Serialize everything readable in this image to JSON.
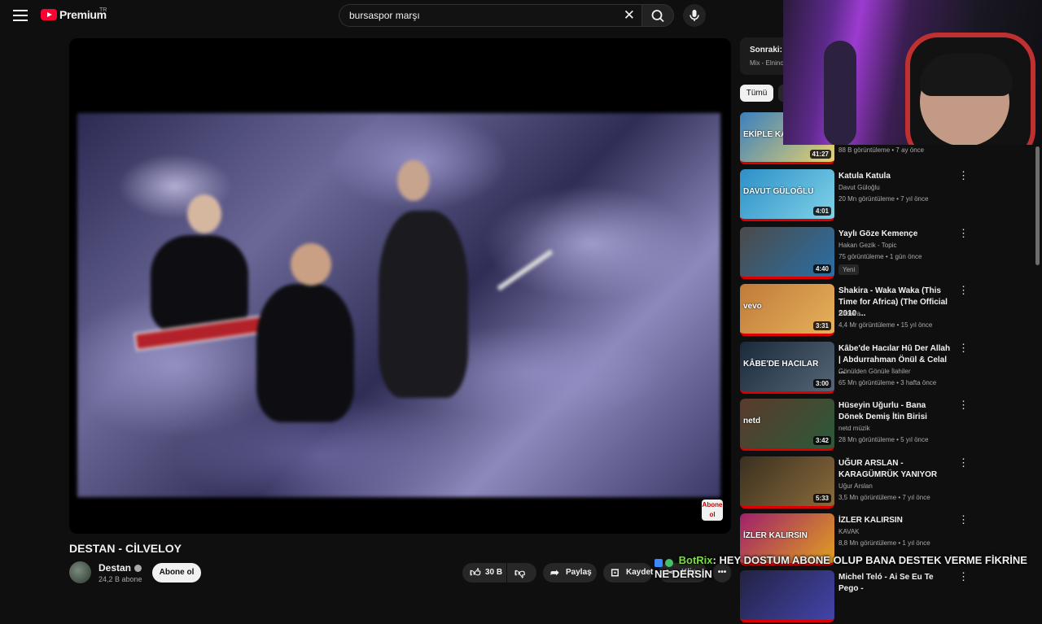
{
  "header": {
    "logo_text": "Premium",
    "country_code": "TR",
    "search_value": "bursaspor marşı"
  },
  "video": {
    "title": "DESTAN - CİLVELOY",
    "overlay_badge": "Abone ol"
  },
  "channel": {
    "name": "Destan",
    "subscribers": "24,2 B abone",
    "subscribe_label": "Abone ol"
  },
  "actions": {
    "like_count": "30 B",
    "share_label": "Paylaş",
    "save_label": "Kaydet",
    "clip_label": "Klip"
  },
  "sidebar": {
    "next_title": "Sonraki: K",
    "next_sub": "Mix - Elninc",
    "chip_all": "Tümü",
    "items": [
      {
        "title": "",
        "channel": "",
        "meta": "88 B görüntüleme • 7 ay önce",
        "duration": "41:27",
        "thumb_text": "EKİPLE KAMP YAPTIK",
        "colors": [
          "#3a7fc0",
          "#e8d26c"
        ]
      },
      {
        "title": "Katula Katula",
        "channel": "Davut Güloğlu",
        "meta": "20 Mn görüntüleme • 7 yıl önce",
        "duration": "4:01",
        "thumb_text": "DAVUT GÜLOĞLU",
        "colors": [
          "#2e8fc8",
          "#7fd3e8"
        ]
      },
      {
        "title": "Yaylı Göze Kemençe",
        "channel": "Hakan Gezik - Topic",
        "meta": "75 görüntüleme • 1 gün önce",
        "duration": "4:40",
        "badge": "Yeni",
        "colors": [
          "#4a4a4a",
          "#2b6fa4"
        ]
      },
      {
        "title": "Shakira - Waka Waka (This Time for Africa) (The Official 2010 ...",
        "channel": "Shakira",
        "meta": "4,4 Mr görüntüleme • 15 yıl önce",
        "duration": "3:31",
        "thumb_text": "vevo",
        "colors": [
          "#c07a3a",
          "#e6b25a"
        ]
      },
      {
        "title": "Kâbe'de Hacılar Hû Der Allah | Abdurrahman Önül & Celal ...",
        "channel": "Gönülden Gönüle İlahiler",
        "meta": "65 Mn görüntüleme • 3 hafta önce",
        "duration": "3:00",
        "thumb_text": "KÂBE'DE HACILAR",
        "colors": [
          "#1a2a3a",
          "#556677"
        ]
      },
      {
        "title": "Hüseyin Uğurlu - Bana Dönek Demiş İtin Birisi",
        "channel": "netd müzik",
        "meta": "28 Mn görüntüleme • 5 yıl önce",
        "duration": "3:42",
        "thumb_text": "netd",
        "colors": [
          "#5a3a2a",
          "#2c5a3a"
        ]
      },
      {
        "title": "UĞUR ARSLAN - KARAGÜMRÜK YANIYOR",
        "channel": "Uğur Arslan",
        "meta": "3,5 Mn görüntüleme • 7 yıl önce",
        "duration": "5:33",
        "colors": [
          "#3a3020",
          "#8a6a3a"
        ]
      },
      {
        "title": "İZLER KALIRSIN",
        "channel": "KAVAK",
        "meta": "8,8 Mn görüntüleme • 1 yıl önce",
        "duration": "",
        "thumb_text": "İZLER KALIRSIN",
        "colors": [
          "#a0206a",
          "#e0a020"
        ]
      },
      {
        "title": "Michel Teló - Ai Se Eu Te Pego -",
        "channel": "",
        "meta": "",
        "duration": "",
        "colors": [
          "#222244",
          "#4444aa"
        ]
      }
    ]
  },
  "chat": {
    "user": "BotRix",
    "message": ": HEY DOSTUM ABONE OLUP BANA DESTEK VERME FİKRİNE NE DERSİN"
  }
}
